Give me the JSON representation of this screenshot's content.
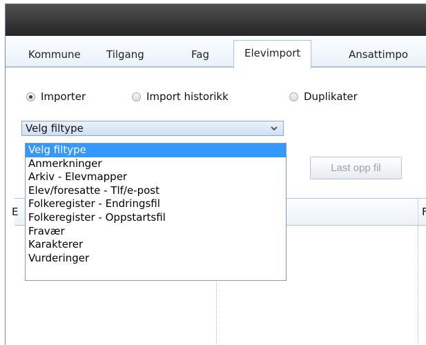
{
  "tabs": [
    {
      "label": "Kommune"
    },
    {
      "label": "Tilgang"
    },
    {
      "label": "Fag"
    },
    {
      "label": "Elevimport",
      "active": true
    },
    {
      "label": "Ansattimpo"
    }
  ],
  "import_mode": {
    "options": [
      {
        "label": "Importer",
        "checked": true
      },
      {
        "label": "Import historikk",
        "checked": false
      },
      {
        "label": "Duplikater",
        "checked": false
      }
    ]
  },
  "file_type": {
    "selected": "Velg filtype",
    "options": [
      "Velg filtype",
      "Anmerkninger",
      "Arkiv - Elevmapper",
      "Elev/foresatte - Tlf/e-post",
      "Folkeregister - Endringsfil",
      "Folkeregister - Oppstartsfil",
      "Fravær",
      "Karakterer",
      "Vurderinger"
    ]
  },
  "upload_button": {
    "label": "Last opp fil"
  },
  "grid": {
    "col1_header": "E",
    "col3_header": "F"
  },
  "colors": {
    "accent": "#3399ff",
    "titlebar": "#3a3a3a",
    "border": "#aac2dc"
  },
  "icons": {
    "select_arrow": "chevron-down-icon"
  }
}
